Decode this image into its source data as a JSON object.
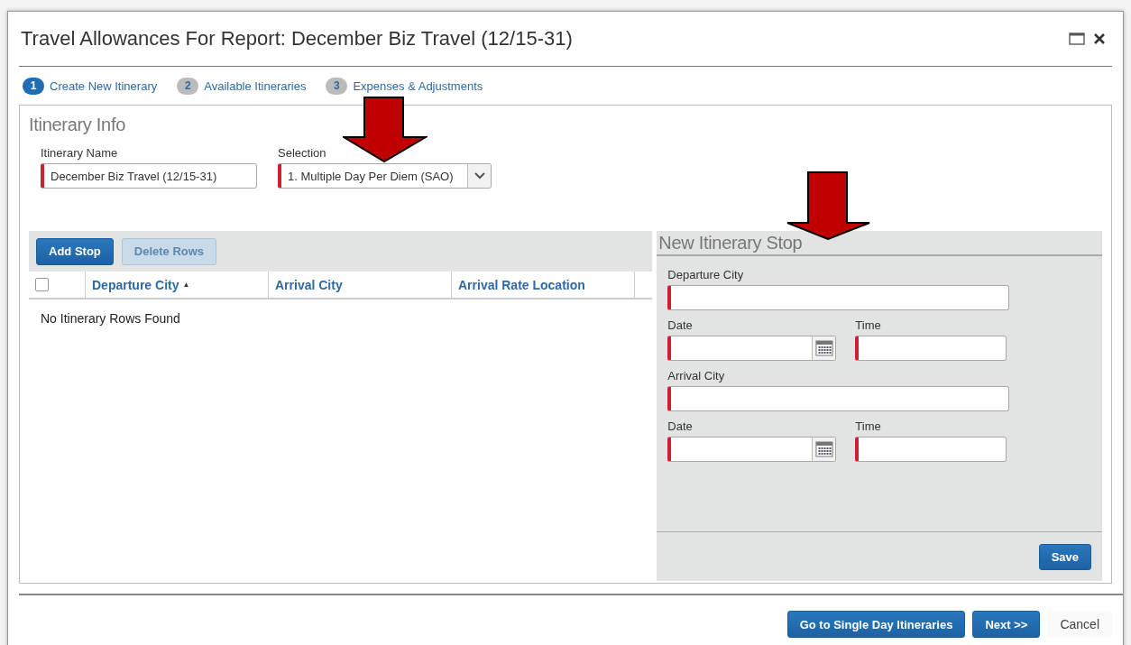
{
  "window": {
    "title": "Travel Allowances For Report: December Biz Travel (12/15-31)"
  },
  "steps": [
    {
      "number": "1",
      "label": "Create New Itinerary",
      "selected": true
    },
    {
      "number": "2",
      "label": "Available Itineraries",
      "selected": false
    },
    {
      "number": "3",
      "label": "Expenses & Adjustments",
      "selected": false
    }
  ],
  "itinerary_info": {
    "heading": "Itinerary Info",
    "fields": [
      {
        "label": "Itinerary Name",
        "value": "December Biz Travel (12/15-31)",
        "required": true,
        "kind": "text"
      },
      {
        "label": "Selection",
        "value": "1. Multiple Day Per Diem (SAO)",
        "required": true,
        "kind": "select"
      }
    ]
  },
  "toolbar": [
    {
      "label": "Add Stop",
      "disabled": false
    },
    {
      "label": "Delete Rows",
      "disabled": true
    }
  ],
  "table": {
    "select_all": {
      "checked": false
    },
    "columns": [
      {
        "label": "Departure City",
        "sort_mark": "▲"
      },
      {
        "label": "Arrival City"
      },
      {
        "label": "Arrival Rate Location"
      }
    ],
    "empty_message": "No Itinerary Rows Found"
  },
  "new_stop": {
    "heading": "New Itinerary Stop",
    "rows": [
      [
        {
          "label": "Departure City",
          "kind": "text",
          "required": true
        }
      ],
      [
        {
          "label": "Date",
          "kind": "date",
          "required": true
        },
        {
          "label": "Time",
          "kind": "text",
          "required": true
        }
      ],
      [
        {
          "label": "Arrival City",
          "kind": "text",
          "required": true
        }
      ],
      [
        {
          "label": "Date",
          "kind": "date",
          "required": true
        },
        {
          "label": "Time",
          "kind": "text",
          "required": true
        }
      ]
    ],
    "save": "Save"
  },
  "footer": [
    {
      "label": "Go to Single Day Itineraries",
      "kind": "primary"
    },
    {
      "label": "Next >>",
      "kind": "primary"
    },
    {
      "label": "Cancel",
      "kind": "plain"
    }
  ]
}
